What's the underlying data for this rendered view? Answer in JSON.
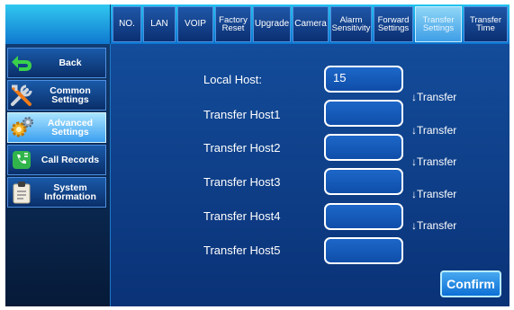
{
  "tabs": [
    {
      "label": "NO."
    },
    {
      "label": "LAN"
    },
    {
      "label": "VOIP"
    },
    {
      "label": "Factory Reset"
    },
    {
      "label": "Upgrade"
    },
    {
      "label": "Camera"
    },
    {
      "label": "Alarm Sensitivity"
    },
    {
      "label": "Forward Settings"
    },
    {
      "label": "Transfer Settings"
    },
    {
      "label": "Transfer Time"
    }
  ],
  "sidebar": {
    "items": [
      {
        "label": "Back",
        "icon": "back-arrow-icon"
      },
      {
        "label": "Common Settings",
        "icon": "tools-icon"
      },
      {
        "label": "Advanced Settings",
        "icon": "gears-icon"
      },
      {
        "label": "Call Records",
        "icon": "call-records-icon"
      },
      {
        "label": "System Information",
        "icon": "clipboard-icon"
      }
    ]
  },
  "form": {
    "local_host_label": "Local Host:",
    "local_host_value": "15",
    "hosts": [
      {
        "label": "Transfer Host1",
        "value": ""
      },
      {
        "label": "Transfer Host2",
        "value": ""
      },
      {
        "label": "Transfer Host3",
        "value": ""
      },
      {
        "label": "Transfer Host4",
        "value": ""
      },
      {
        "label": "Transfer Host5",
        "value": ""
      }
    ],
    "transfer_links": [
      "↓Transfer",
      "↓Transfer",
      "↓Transfer",
      "↓Transfer",
      "↓Transfer"
    ]
  },
  "confirm_label": "Confirm",
  "colors": {
    "accent": "#1e7fe0",
    "panel": "#134c9a",
    "sidebar": "#0a2f69"
  }
}
